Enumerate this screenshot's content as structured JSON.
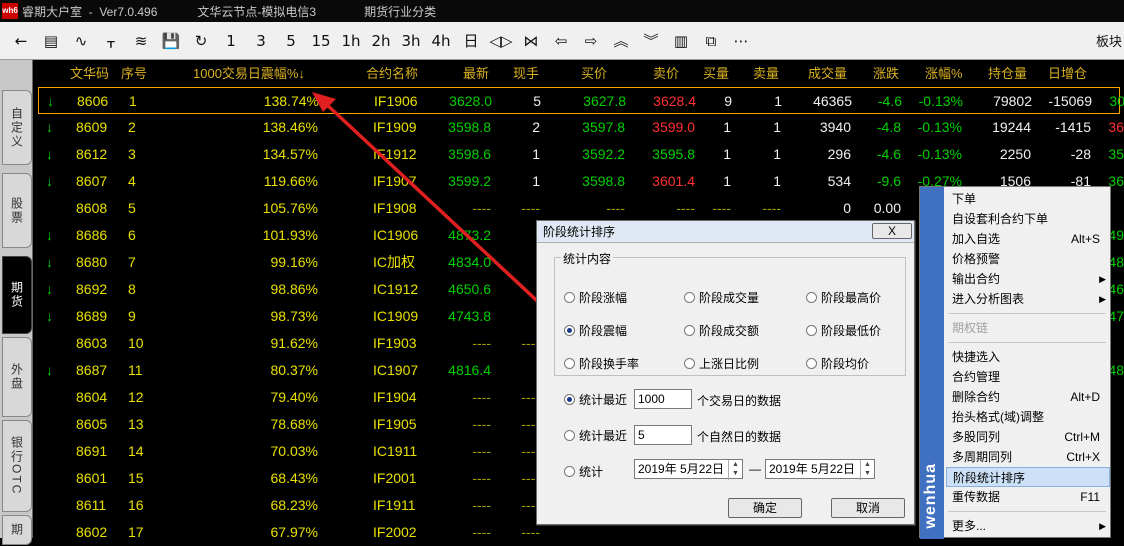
{
  "title": {
    "app": "睿期大户室  -  Ver7.0.496",
    "node": "文华云节点-模拟电信3",
    "category": "期货行业分类",
    "logo": "wh6"
  },
  "toolbar": {
    "buttons": [
      "←",
      "▤",
      "∿",
      "ᚁ",
      "≋",
      "💾",
      "↻",
      "1",
      "3",
      "5",
      "15",
      "1h",
      "2h",
      "3h",
      "4h",
      "日",
      "◁▷",
      "⋈",
      "⇦",
      "⇨",
      "︽",
      "︾",
      "▥",
      "⧉",
      "⋯"
    ],
    "right_label": "板块"
  },
  "sidebar": {
    "tabs": [
      "自定义",
      "股票",
      "期货",
      "外盘",
      "银行OTC",
      "期"
    ]
  },
  "headers": {
    "code": "文华码",
    "seq": "序号",
    "amp": "1000交易日震幅%↓",
    "name": "合约名称",
    "last": "最新",
    "vol_hand": "现手",
    "bid": "买价",
    "ask": "卖价",
    "bidq": "买量",
    "askq": "卖量",
    "vol": "成交量",
    "chg": "涨跌",
    "pct": "涨幅%",
    "oi": "持仓量",
    "inc": "日增仓"
  },
  "rows": [
    {
      "a": "↓",
      "code": "8606",
      "seq": "1",
      "amp": "138.74%",
      "name": "IF1906",
      "last": "3628.0",
      "hand": "5",
      "bid": "3627.8",
      "ask": "3628.4",
      "bq": "9",
      "aq": "1",
      "vol": "46365",
      "chg": "-4.6",
      "pct": "-0.13%",
      "oi": "79802",
      "inc": "-15069",
      "x": "30"
    },
    {
      "a": "↓",
      "code": "8609",
      "seq": "2",
      "amp": "138.46%",
      "name": "IF1909",
      "last": "3598.8",
      "hand": "2",
      "bid": "3597.8",
      "ask": "3599.0",
      "bq": "1",
      "aq": "1",
      "vol": "3940",
      "chg": "-4.8",
      "pct": "-0.13%",
      "oi": "19244",
      "inc": "-1415",
      "x": "36"
    },
    {
      "a": "↓",
      "code": "8612",
      "seq": "3",
      "amp": "134.57%",
      "name": "IF1912",
      "last": "3598.6",
      "hand": "1",
      "bid": "3592.2",
      "ask": "3595.8",
      "bq": "1",
      "aq": "1",
      "vol": "296",
      "chg": "-4.6",
      "pct": "-0.13%",
      "oi": "2250",
      "inc": "-28",
      "x": "35"
    },
    {
      "a": "↓",
      "code": "8607",
      "seq": "4",
      "amp": "119.66%",
      "name": "IF1907",
      "last": "3599.2",
      "hand": "1",
      "bid": "3598.8",
      "ask": "3601.4",
      "bq": "1",
      "aq": "1",
      "vol": "534",
      "chg": "-9.6",
      "pct": "-0.27%",
      "oi": "1506",
      "inc": "-81",
      "x": "36"
    },
    {
      "a": "",
      "code": "8608",
      "seq": "5",
      "amp": "105.76%",
      "name": "IF1908",
      "last": "----",
      "hand": "----",
      "bid": "----",
      "ask": "----",
      "bq": "----",
      "aq": "----",
      "vol": "0",
      "chg": "0.00",
      "pct": "",
      "oi": "",
      "inc": "",
      "x": ""
    },
    {
      "a": "↓",
      "code": "8686",
      "seq": "6",
      "amp": "101.93%",
      "name": "IC1906",
      "last": "4873.2",
      "hand": "",
      "bid": "",
      "ask": "",
      "bq": "",
      "aq": "",
      "vol": "",
      "chg": "",
      "pct": "",
      "oi": "",
      "inc": "",
      "x": "49"
    },
    {
      "a": "↓",
      "code": "8680",
      "seq": "7",
      "amp": "99.16%",
      "name": "IC加权",
      "last": "4834.0",
      "hand": "",
      "bid": "",
      "ask": "",
      "bq": "",
      "aq": "",
      "vol": "",
      "chg": "",
      "pct": "",
      "oi": "",
      "inc": "",
      "x": "48"
    },
    {
      "a": "↓",
      "code": "8692",
      "seq": "8",
      "amp": "98.86%",
      "name": "IC1912",
      "last": "4650.6",
      "hand": "",
      "bid": "",
      "ask": "",
      "bq": "",
      "aq": "",
      "vol": "",
      "chg": "",
      "pct": "",
      "oi": "",
      "inc": "",
      "x": "46"
    },
    {
      "a": "↓",
      "code": "8689",
      "seq": "9",
      "amp": "98.73%",
      "name": "IC1909",
      "last": "4743.8",
      "hand": "",
      "bid": "",
      "ask": "",
      "bq": "",
      "aq": "",
      "vol": "",
      "chg": "",
      "pct": "",
      "oi": "",
      "inc": "",
      "x": "47"
    },
    {
      "a": "",
      "code": "8603",
      "seq": "10",
      "amp": "91.62%",
      "name": "IF1903",
      "last": "----",
      "hand": "----",
      "bid": "",
      "ask": "",
      "bq": "",
      "aq": "",
      "vol": "",
      "chg": "",
      "pct": "",
      "oi": "",
      "inc": "",
      "x": ""
    },
    {
      "a": "↓",
      "code": "8687",
      "seq": "11",
      "amp": "80.37%",
      "name": "IC1907",
      "last": "4816.4",
      "hand": "",
      "bid": "",
      "ask": "",
      "bq": "",
      "aq": "",
      "vol": "",
      "chg": "",
      "pct": "",
      "oi": "",
      "inc": "",
      "x": "48"
    },
    {
      "a": "",
      "code": "8604",
      "seq": "12",
      "amp": "79.40%",
      "name": "IF1904",
      "last": "----",
      "hand": "----",
      "bid": "",
      "ask": "",
      "bq": "",
      "aq": "",
      "vol": "",
      "chg": "",
      "pct": "",
      "oi": "",
      "inc": "",
      "x": ""
    },
    {
      "a": "",
      "code": "8605",
      "seq": "13",
      "amp": "78.68%",
      "name": "IF1905",
      "last": "----",
      "hand": "----",
      "bid": "",
      "ask": "",
      "bq": "",
      "aq": "",
      "vol": "",
      "chg": "",
      "pct": "",
      "oi": "",
      "inc": "",
      "x": ""
    },
    {
      "a": "",
      "code": "8691",
      "seq": "14",
      "amp": "70.03%",
      "name": "IC1911",
      "last": "----",
      "hand": "----",
      "bid": "",
      "ask": "",
      "bq": "",
      "aq": "",
      "vol": "",
      "chg": "",
      "pct": "",
      "oi": "",
      "inc": "",
      "x": ""
    },
    {
      "a": "",
      "code": "8601",
      "seq": "15",
      "amp": "68.43%",
      "name": "IF2001",
      "last": "----",
      "hand": "----",
      "bid": "",
      "ask": "",
      "bq": "",
      "aq": "",
      "vol": "",
      "chg": "",
      "pct": "",
      "oi": "",
      "inc": "",
      "x": ""
    },
    {
      "a": "",
      "code": "8611",
      "seq": "16",
      "amp": "68.23%",
      "name": "IF1911",
      "last": "----",
      "hand": "----",
      "bid": "",
      "ask": "",
      "bq": "",
      "aq": "",
      "vol": "",
      "chg": "",
      "pct": "",
      "oi": "",
      "inc": "",
      "x": ""
    },
    {
      "a": "",
      "code": "8602",
      "seq": "17",
      "amp": "67.97%",
      "name": "IF2002",
      "last": "----",
      "hand": "----",
      "bid": "",
      "ask": "",
      "bq": "",
      "aq": "",
      "vol": "",
      "chg": "",
      "pct": "",
      "oi": "",
      "inc": "",
      "x": ""
    }
  ],
  "dialog": {
    "title": "阶段统计排序",
    "close": "X",
    "group": "统计内容",
    "options": [
      "阶段涨幅",
      "阶段成交量",
      "阶段最高价",
      "阶段震幅",
      "阶段成交额",
      "阶段最低价",
      "阶段换手率",
      "上涨日比例",
      "阶段均价"
    ],
    "selected_option": "阶段震幅",
    "recent_trade_label": "统计最近",
    "recent_trade_value": "1000",
    "recent_trade_suffix": "个交易日的数据",
    "recent_nat_label": "统计最近",
    "recent_nat_value": "5",
    "recent_nat_suffix": "个自然日的数据",
    "range_label": "统计",
    "date_from": "2019年 5月22日",
    "date_sep": "—",
    "date_to": "2019年 5月22日",
    "ok": "确定",
    "cancel": "取消"
  },
  "menu": {
    "brand": "wenhua",
    "items": [
      {
        "label": "下单",
        "sc": ""
      },
      {
        "label": "自设套利合约下单",
        "sc": ""
      },
      {
        "label": "加入自选",
        "sc": "Alt+S"
      },
      {
        "label": "价格预警",
        "sc": ""
      },
      {
        "label": "输出合约",
        "sc": "▶"
      },
      {
        "label": "进入分析图表",
        "sc": "▶"
      },
      {
        "label": "期权链",
        "sc": ""
      },
      {
        "label": "快捷选入",
        "sc": ""
      },
      {
        "label": "合约管理",
        "sc": ""
      },
      {
        "label": "删除合约",
        "sc": "Alt+D"
      },
      {
        "label": "抬头格式(域)调整",
        "sc": ""
      },
      {
        "label": "多股同列",
        "sc": "Ctrl+M"
      },
      {
        "label": "多周期同列",
        "sc": "Ctrl+X"
      },
      {
        "label": "阶段统计排序",
        "sc": ""
      },
      {
        "label": "重传数据",
        "sc": "F11"
      },
      {
        "label": "更多...",
        "sc": "▶"
      }
    ]
  },
  "colors": {
    "header": "#d8b020",
    "up": "#ff3030",
    "down": "#00d000",
    "neutral": "#f0f0f0",
    "selected_border": "#ffa500",
    "menu_highlight": "#cce0f8"
  }
}
